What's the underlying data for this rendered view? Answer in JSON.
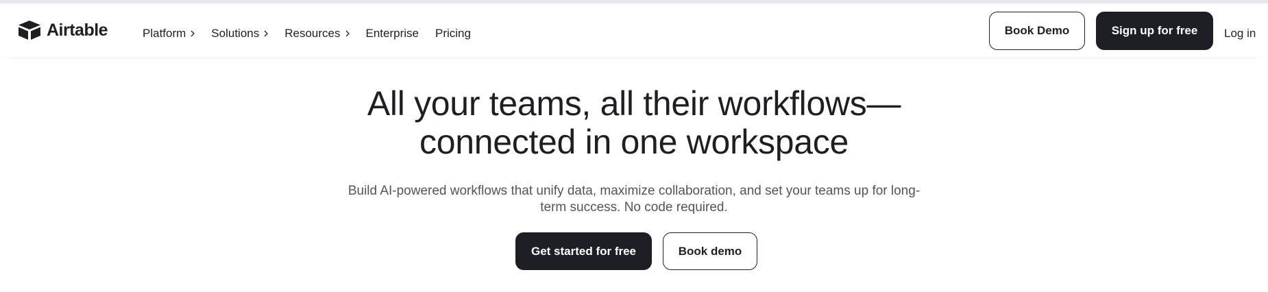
{
  "brand": {
    "name": "Airtable",
    "logo_icon": "airtable-cube-icon"
  },
  "nav": {
    "items": [
      {
        "label": "Platform",
        "has_submenu": true
      },
      {
        "label": "Solutions",
        "has_submenu": true
      },
      {
        "label": "Resources",
        "has_submenu": true
      },
      {
        "label": "Enterprise",
        "has_submenu": false
      },
      {
        "label": "Pricing",
        "has_submenu": false
      }
    ]
  },
  "header_actions": {
    "book_demo": "Book Demo",
    "sign_up": "Sign up for free",
    "log_in": "Log in"
  },
  "hero": {
    "title_line1": "All your teams, all their workflows—",
    "title_line2": "connected in one workspace",
    "subtitle_line1": "Build AI-powered workflows that unify data, maximize collaboration, and set your teams up for long-",
    "subtitle_line2": "term success. No code required.",
    "primary_cta": "Get started for free",
    "secondary_cta": "Book demo"
  },
  "colors": {
    "ink": "#1d1f25",
    "muted_text": "#51545e",
    "background": "#ffffff"
  }
}
